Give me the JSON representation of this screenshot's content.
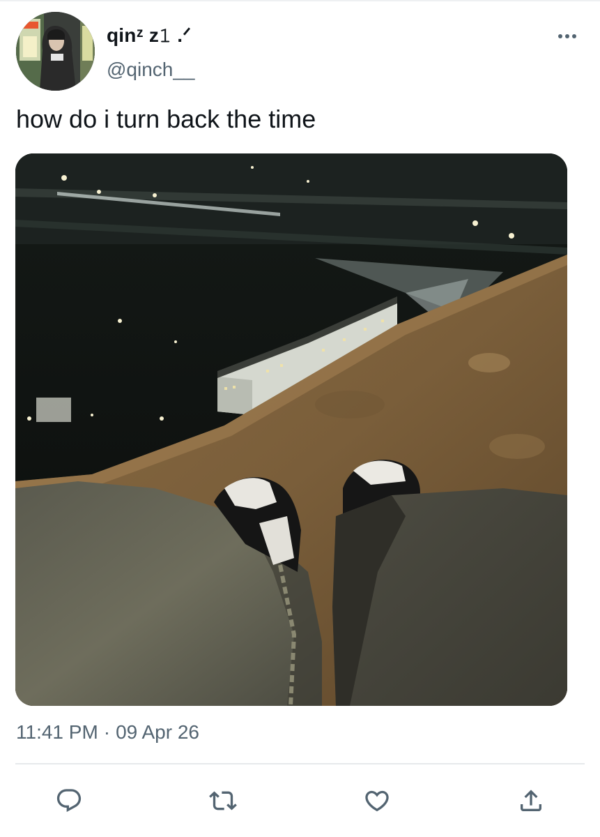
{
  "tweet": {
    "display_name": "qinᶻ z𝟷 .ᐟ",
    "handle": "@qinch__",
    "text": "how do i turn back the time",
    "timestamp": {
      "time": "11:41 PM",
      "separator": "·",
      "date": "09 Apr 26"
    }
  },
  "icons": {
    "more": "more-horizontal-icon",
    "reply": "reply-icon",
    "retweet": "retweet-icon",
    "like": "like-icon",
    "share": "share-icon"
  },
  "colors": {
    "text_primary": "#0f1419",
    "text_secondary": "#536471",
    "icon": "#536471",
    "divider": "#e6e9eb"
  }
}
